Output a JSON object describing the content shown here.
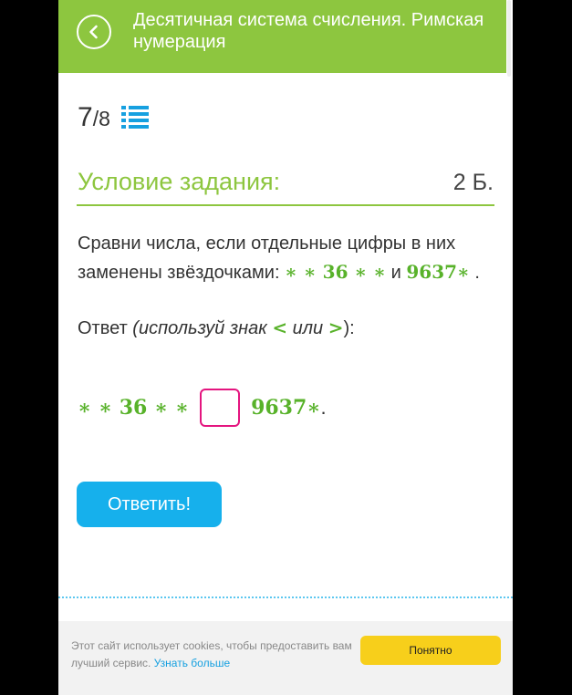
{
  "header": {
    "title": "Десятичная система счисления. Римская нумерация",
    "back_icon": "chevron-left-icon",
    "background": "#8dc63f"
  },
  "progress": {
    "current": "7",
    "separator": "/",
    "total": "8",
    "list_icon": "list-icon"
  },
  "condition": {
    "title": "Условие задания:",
    "points": "2 Б."
  },
  "task": {
    "text_start": "Сравни числа, если отдельные цифры в них заменены звёздочками: ",
    "number1": "∗ ∗ 36 ∗ ∗",
    "conjunction": " и ",
    "number2": "9637∗",
    "text_end": "."
  },
  "answer": {
    "prompt_start": "Ответ ",
    "prompt_hint": "(используй знак ",
    "sign_less": "<",
    "prompt_or": " или ",
    "sign_greater": ">",
    "prompt_end": "):",
    "left_value": "∗ ∗ 36 ∗ ∗",
    "right_value": "9637∗",
    "right_end": "."
  },
  "submit_label": "Ответить!",
  "cookie": {
    "text": "Этот сайт использует cookies, чтобы предоставить вам лучший сервис. ",
    "link": "Узнать больше",
    "button": "Понятно"
  },
  "colors": {
    "accent_green": "#8dc63f",
    "math_green": "#58b22a",
    "button_blue": "#16b0ec",
    "answer_box_border": "#e4157f",
    "cookie_button": "#f7cf1b"
  }
}
